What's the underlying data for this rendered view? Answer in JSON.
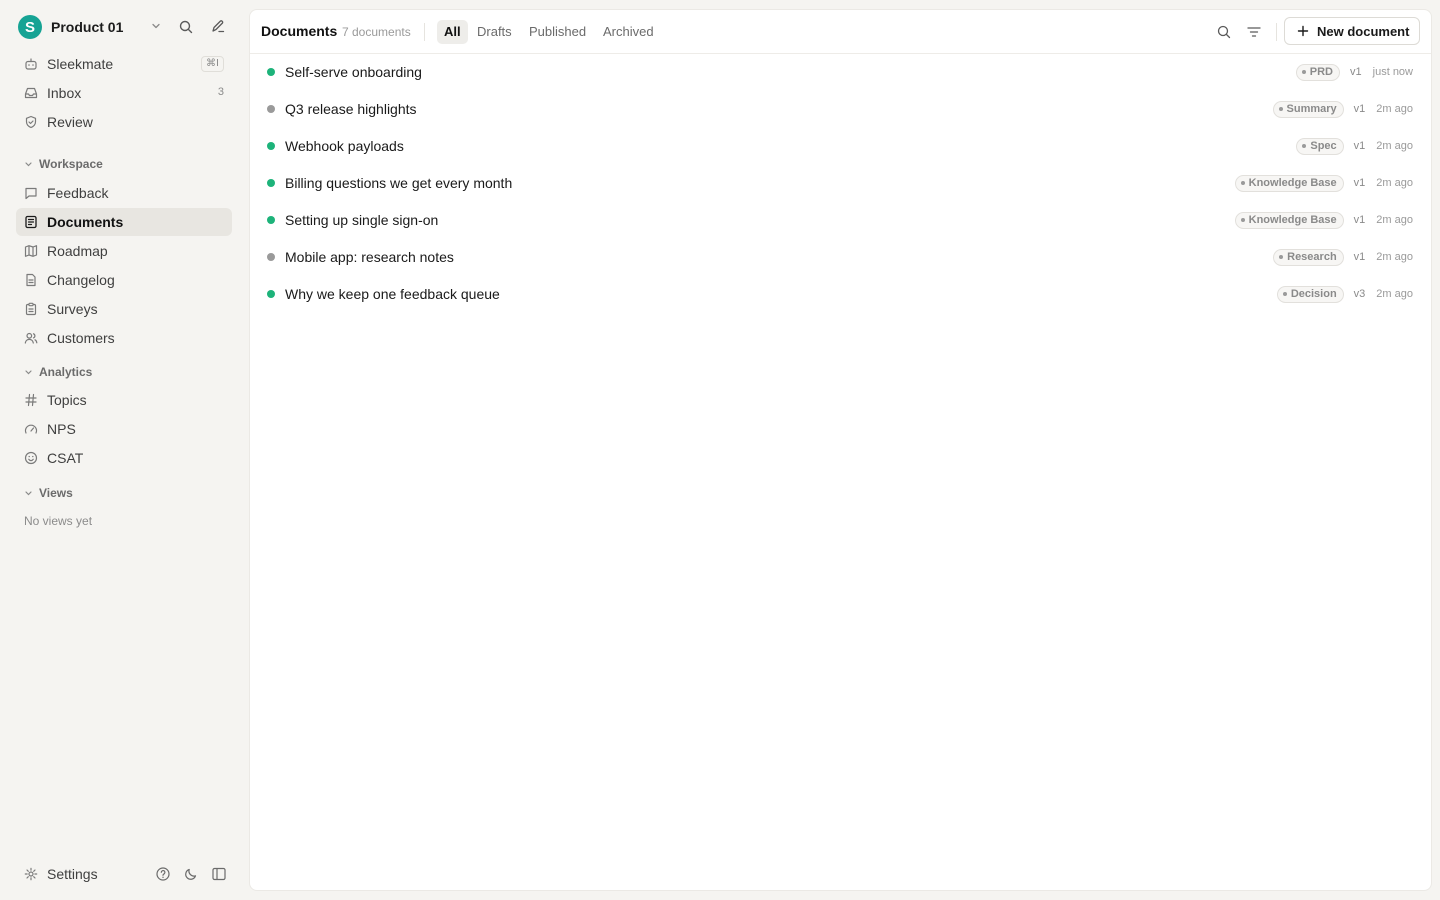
{
  "workspace": {
    "logo_letter": "S",
    "name": "Product 01"
  },
  "sidebar": {
    "top_items": [
      {
        "label": "Sleekmate",
        "shortcut": "⌘I"
      },
      {
        "label": "Inbox",
        "count": "3"
      },
      {
        "label": "Review"
      }
    ],
    "sections": [
      {
        "title": "Workspace",
        "items": [
          {
            "label": "Feedback",
            "icon": "message-square-icon"
          },
          {
            "label": "Documents",
            "icon": "document-icon",
            "active": true
          },
          {
            "label": "Roadmap",
            "icon": "map-icon"
          },
          {
            "label": "Changelog",
            "icon": "file-icon"
          },
          {
            "label": "Surveys",
            "icon": "clipboard-icon"
          },
          {
            "label": "Customers",
            "icon": "users-icon"
          }
        ]
      },
      {
        "title": "Analytics",
        "items": [
          {
            "label": "Topics",
            "icon": "hash-icon"
          },
          {
            "label": "NPS",
            "icon": "gauge-icon"
          },
          {
            "label": "CSAT",
            "icon": "smile-icon"
          }
        ]
      },
      {
        "title": "Views",
        "empty_text": "No views yet"
      }
    ],
    "footer": {
      "settings_label": "Settings"
    }
  },
  "main": {
    "title": "Documents",
    "count_label": "7 documents",
    "tabs": [
      {
        "label": "All",
        "active": true
      },
      {
        "label": "Drafts"
      },
      {
        "label": "Published"
      },
      {
        "label": "Archived"
      }
    ],
    "new_button_label": "New document",
    "documents": [
      {
        "title": "Self-serve onboarding",
        "status_color": "#1db37a",
        "tag": "PRD",
        "version": "v1",
        "time": "just now"
      },
      {
        "title": "Q3 release highlights",
        "status_color": "#9a9a9a",
        "tag": "Summary",
        "version": "v1",
        "time": "2m ago"
      },
      {
        "title": "Webhook payloads",
        "status_color": "#1db37a",
        "tag": "Spec",
        "version": "v1",
        "time": "2m ago"
      },
      {
        "title": "Billing questions we get every month",
        "status_color": "#1db37a",
        "tag": "Knowledge Base",
        "version": "v1",
        "time": "2m ago"
      },
      {
        "title": "Setting up single sign-on",
        "status_color": "#1db37a",
        "tag": "Knowledge Base",
        "version": "v1",
        "time": "2m ago"
      },
      {
        "title": "Mobile app: research notes",
        "status_color": "#9a9a9a",
        "tag": "Research",
        "version": "v1",
        "time": "2m ago"
      },
      {
        "title": "Why we keep one feedback queue",
        "status_color": "#1db37a",
        "tag": "Decision",
        "version": "v3",
        "time": "2m ago"
      }
    ]
  },
  "colors": {
    "brand": "#16a394",
    "published": "#1db37a",
    "draft": "#9a9a9a"
  }
}
